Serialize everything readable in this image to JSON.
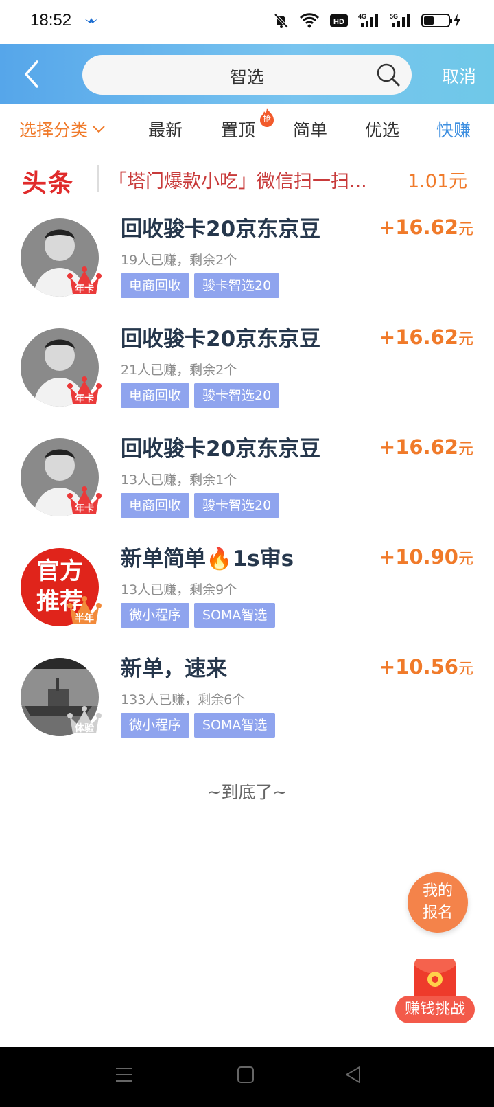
{
  "status_bar": {
    "time": "18:52",
    "network_a": "4G",
    "network_b": "5G",
    "hd": "HD"
  },
  "header": {
    "search_value": "智选",
    "cancel_label": "取消"
  },
  "tabs": [
    {
      "label": "选择分类"
    },
    {
      "label": "最新"
    },
    {
      "label": "置顶",
      "badge": "抢"
    },
    {
      "label": "简单"
    },
    {
      "label": "优选"
    },
    {
      "label": "快赚"
    }
  ],
  "headline": {
    "logo": "头条",
    "text": "「塔门爆款小吃」微信扫一扫...",
    "price": "1.01元"
  },
  "tasks": [
    {
      "title": "回收骏卡20京东京豆",
      "stats": "19人已赚，剩余2个",
      "tags": [
        "电商回收",
        "骏卡智选20"
      ],
      "price": "+16.62",
      "unit": "元",
      "badge": "年卡",
      "avatar": "portrait"
    },
    {
      "title": "回收骏卡20京东京豆",
      "stats": "21人已赚，剩余2个",
      "tags": [
        "电商回收",
        "骏卡智选20"
      ],
      "price": "+16.62",
      "unit": "元",
      "badge": "年卡",
      "avatar": "portrait"
    },
    {
      "title": "回收骏卡20京东京豆",
      "stats": "13人已赚，剩余1个",
      "tags": [
        "电商回收",
        "骏卡智选20"
      ],
      "price": "+16.62",
      "unit": "元",
      "badge": "年卡",
      "avatar": "portrait"
    },
    {
      "title": "新单简单🔥1s审s",
      "stats": "13人已赚，剩余9个",
      "tags": [
        "微小程序",
        "SOMA智选"
      ],
      "price": "+10.90",
      "unit": "元",
      "badge": "半年",
      "avatar": "official",
      "avatar_text": [
        "官方",
        "推荐"
      ]
    },
    {
      "title": "新单，速来",
      "stats": "133人已赚，剩余6个",
      "tags": [
        "微小程序",
        "SOMA智选"
      ],
      "price": "+10.56",
      "unit": "元",
      "badge": "体验",
      "avatar": "ship"
    }
  ],
  "list_end": "~到底了~",
  "floating": {
    "signup_line1": "我的",
    "signup_line2": "报名",
    "challenge": "赚钱挑战"
  },
  "colors": {
    "accent_orange": "#f07a2a",
    "tag_blue": "#8fa4ee",
    "header_blue": "#56a6ea",
    "headline_red": "#e02b2b"
  }
}
